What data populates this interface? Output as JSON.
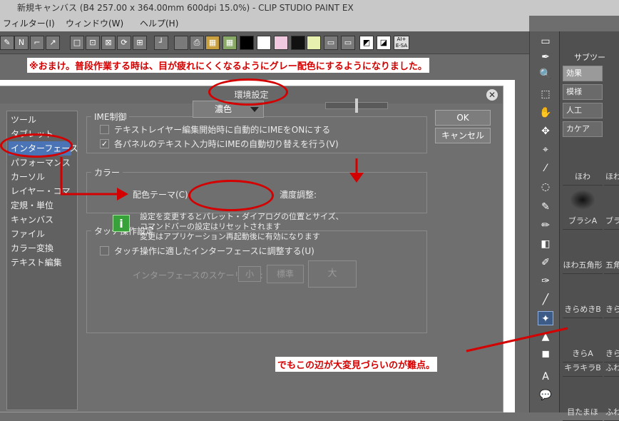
{
  "window": {
    "title": "新規キャンバス (B4 257.00 x 364.00mm 600dpi 15.0%)  - CLIP STUDIO PAINT EX"
  },
  "menu": {
    "items": [
      "フィルター(I)",
      "ウィンドウ(W)",
      "ヘルプ(H)"
    ]
  },
  "toolbar_labels": {
    "ai_badge": "AI+ E-SA"
  },
  "annotations": {
    "top_note": "※おまけ。普段作業する時は、目が疲れにくくなるようにグレー配色にするようになりました。",
    "bottom_note": "でもこの辺が大変見づらいのが難点。"
  },
  "dialog": {
    "title": "環境設定",
    "categories": [
      "ツール",
      "タブレット",
      "インターフェース",
      "パフォーマンス",
      "カーソル",
      "レイヤー・コマ",
      "定規・単位",
      "キャンバス",
      "ファイル",
      "カラー変換",
      "テキスト編集"
    ],
    "selected_category": "インターフェース",
    "ok": "OK",
    "cancel": "キャンセル",
    "ime": {
      "title": "IME制御",
      "opt1": "テキストレイヤー編集開始時に自動的にIMEをONにする",
      "opt1_checked": false,
      "opt2": "各パネルのテキスト入力時にIMEの自動切り替えを行う(V)",
      "opt2_checked": true
    },
    "color": {
      "title": "カラー",
      "theme_label": "配色テーマ(C):",
      "theme_value": "濃色",
      "density_label": "濃度調整:",
      "density_level": 0.5
    },
    "touch": {
      "title": "タッチ操作設定",
      "opt": "タッチ操作に適したインターフェースに調整する(U)",
      "opt_checked": false,
      "scaling_label": "インターフェースのスケーリング:",
      "small": "小",
      "standard": "標準",
      "large": "大",
      "info_line1": "設定を変更するとパレット・ダイアログの位置とサイズ、",
      "info_line2": "コマンドバーの設定はリセットされます",
      "info_line3": "変更はアプリケーション再起動後に有効になります"
    }
  },
  "brush_panel": {
    "tab_label": "サブツー",
    "tabs": [
      "効果",
      "模様",
      "人工",
      "カケア"
    ],
    "brushes": [
      "ほわ",
      "ブラシA",
      "ほわ五角形",
      "きらめきB",
      "きらA",
      "キラキラB",
      "目たまほ"
    ],
    "brushes_right": [
      "ほわ",
      "ブラシ",
      "五角",
      "きらめ",
      "きら",
      "ふわ",
      "ふわ"
    ]
  },
  "colors": {
    "accent_red": "#d40000",
    "selected_blue": "#4a74b5"
  }
}
